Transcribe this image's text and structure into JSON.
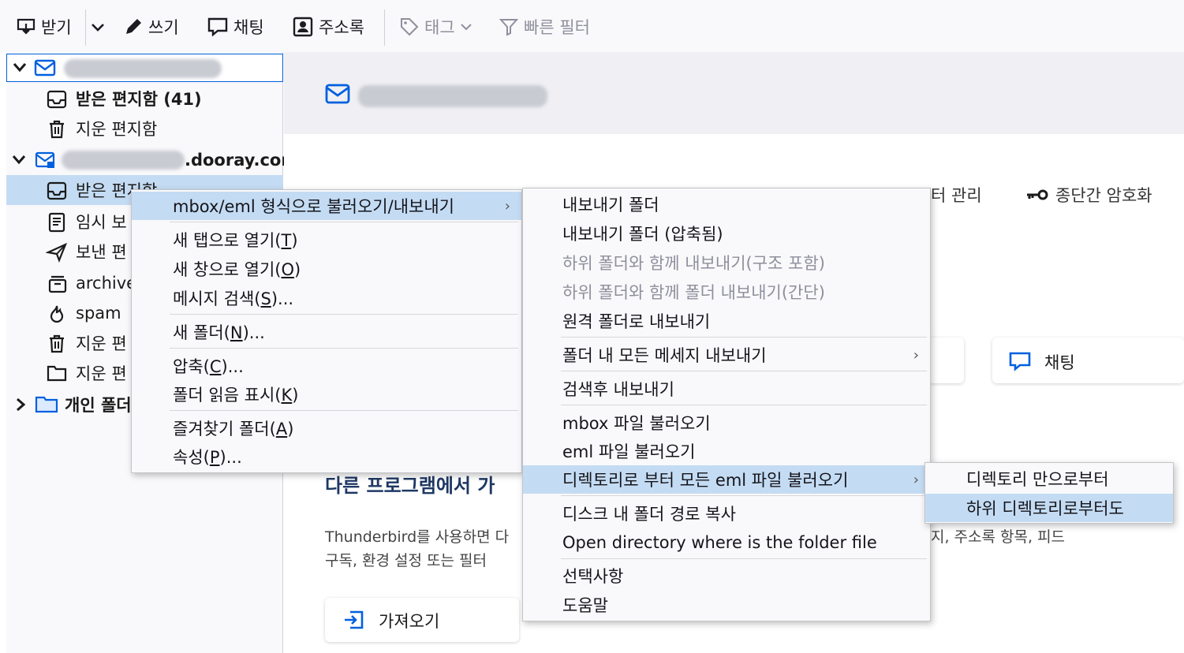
{
  "toolbar": {
    "get_messages": "받기",
    "write": "쓰기",
    "chat": "채팅",
    "address_book": "주소록",
    "tag": "태그",
    "quick_filter": "빠른 필터"
  },
  "folders": {
    "account2_domain": ".dooray.com",
    "inbox": "받은 편지함 (41)",
    "trash": "지운 편지함",
    "inbox2": "받은 편지함",
    "drafts": "임시 보",
    "sent": "보낸 편",
    "archive": "archive",
    "spam": "spam",
    "trash2": "지운 편",
    "deleted_folder": "지운 편",
    "local_folders": "개인 폴더"
  },
  "content": {
    "toolbar_right1": "터 관리",
    "toolbar_right2": "종단간 암호화",
    "chat_card": "채팅",
    "import_heading": "다른 프로그램에서 가",
    "import_text_line1": "Thunderbird를 사용하면 다",
    "import_text_line2": "구독, 환경 설정 또는 필터",
    "import_text_right": "지, 주소록 항목, 피드",
    "import_button": "가져오기"
  },
  "context_menu": {
    "items": [
      {
        "label": "mbox/eml 형식으로 불러오기/내보내기",
        "submenu": true
      },
      {
        "label": "새 탭으로 열기",
        "key": "T"
      },
      {
        "label": "새 창으로 열기",
        "key": "O"
      },
      {
        "label": "메시지 검색",
        "key": "S",
        "suffix": "..."
      },
      {
        "label": "새 폴더",
        "key": "N",
        "suffix": "..."
      },
      {
        "label": "압축",
        "key": "C",
        "suffix": "..."
      },
      {
        "label": "폴더 읽음 표시",
        "key": "K"
      },
      {
        "label": "즐겨찾기 폴더",
        "key": "A"
      },
      {
        "label": "속성",
        "key": "P",
        "suffix": "..."
      }
    ]
  },
  "submenu": {
    "items": [
      "내보내기 폴더",
      "내보내기 폴더 (압축됨)",
      "하위 폴더와 함께 내보내기(구조 포함)",
      "하위 폴더와 함께 폴더 내보내기(간단)",
      "원격 폴더로 내보내기",
      "폴더 내 모든 메세지 내보내기",
      "검색후 내보내기",
      "mbox 파일 불러오기",
      "eml 파일 불러오기",
      "디렉토리로 부터 모든 eml 파일 불러오기",
      "디스크 내 폴더 경로 복사",
      "Open directory where is the folder file",
      "선택사항",
      "도움말"
    ]
  },
  "submenu2": {
    "items": [
      "디렉토리 만으로부터",
      "하위 디렉토리로부터도"
    ]
  },
  "colors": {
    "accent": "#0060df",
    "selected": "#c4dcf3",
    "disabled": "#8f8f9d"
  }
}
